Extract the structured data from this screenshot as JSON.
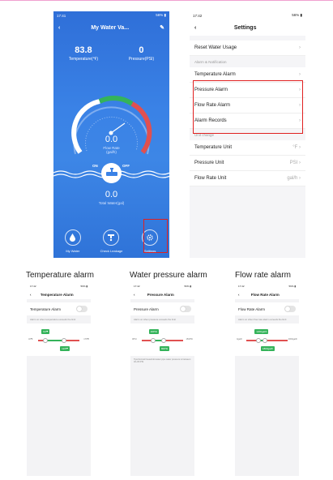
{
  "home": {
    "status_time": "17:41",
    "status_right": "56% ▮",
    "title": "My Water Va...",
    "temperature": {
      "value": "83.8",
      "label": "Temperature(℉)"
    },
    "pressure": {
      "value": "0",
      "label": "Pressure(PSI)"
    },
    "flow": {
      "value": "0.0",
      "label1": "Flow Rate",
      "label2": "(gal/h)"
    },
    "valve": {
      "on": "ON",
      "off": "OFF"
    },
    "total": {
      "value": "0.0",
      "label": "Total Water(gal)"
    },
    "nav": [
      {
        "label": "My Water",
        "icon": "water-drop-icon"
      },
      {
        "label": "Check Leakage",
        "icon": "leak-check-icon"
      },
      {
        "label": "Settings",
        "icon": "gear-icon"
      }
    ]
  },
  "settings": {
    "status_time": "17:42",
    "status_right": "56% ▮",
    "title": "Settings",
    "reset": "Reset Water Usage",
    "section_alarm": "Alarm & Notification",
    "alarms": [
      "Temperature Alarm",
      "Pressure Alarm",
      "Flow Rate Alarm"
    ],
    "records": "Alarm Records",
    "section_unit": "Unit change",
    "units": [
      {
        "label": "Temperature Unit",
        "value": "°F"
      },
      {
        "label": "Pressure Unit",
        "value": "PSI"
      },
      {
        "label": "Flow Rate Unit",
        "value": "gal/h"
      }
    ]
  },
  "captions": [
    "Temperature alarm",
    "Water pressure alarm",
    "Flow rate alarm"
  ],
  "small_screens": [
    {
      "title": "Temperature Alarm",
      "row": "Temperature Alarm",
      "note": "Alarm on when temperature exceeds the limit",
      "min_label": "32℉",
      "max_label": "176℉",
      "low_pill": "64℉",
      "high_pill": "122℉",
      "low_frac": 0.18,
      "high_frac": 0.63,
      "tip": ""
    },
    {
      "title": "Pressure Alarm",
      "row": "Pressure Alarm",
      "note": "Alarm on when pressure exceeds the limit",
      "min_label": "0PSI",
      "max_label": "150PSI",
      "low_pill": "40PSI",
      "high_pill": "80PSI",
      "low_frac": 0.27,
      "high_frac": 0.53,
      "tip": "Tips:Normal household water pipe water pressure is between 40~80 PSI"
    },
    {
      "title": "Flow Rate Alarm",
      "row": "Flow Rate Alarm",
      "note": "Alarm on when flow rate alarm exceeds the limit",
      "min_label": "0gal/h",
      "max_label": "4000gal/h",
      "low_pill": "1200gal/h",
      "high_pill": "1800gal/h",
      "low_frac": 0.3,
      "high_frac": 0.45,
      "tip": ""
    }
  ],
  "colors": {
    "accent_blue": "#3a82e6",
    "green": "#34b35a",
    "red": "#e05050",
    "highlight": "#e02020"
  }
}
